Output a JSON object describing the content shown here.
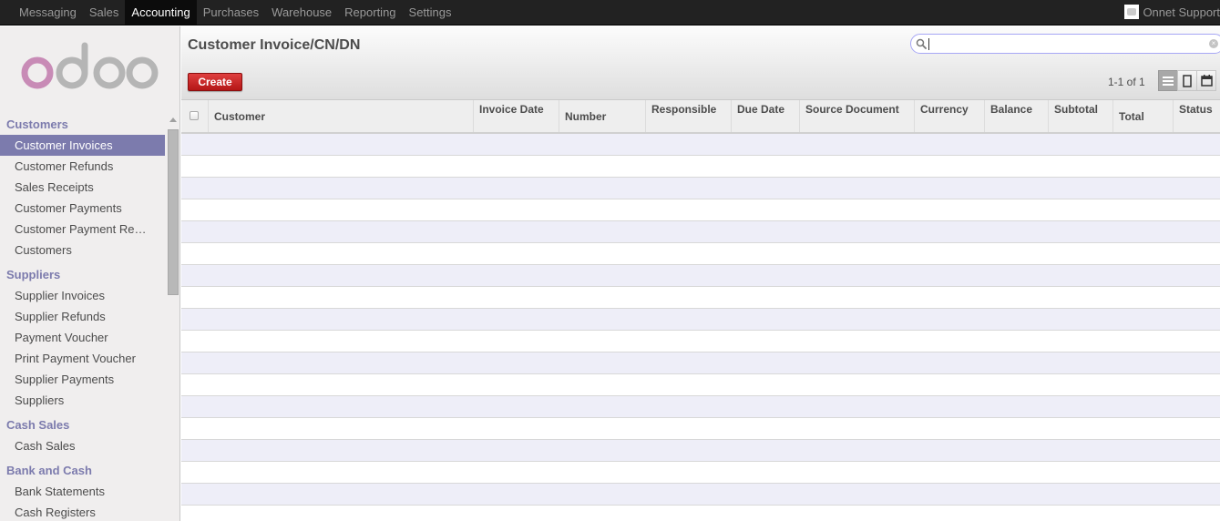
{
  "topbar": {
    "menu": [
      "Messaging",
      "Sales",
      "Accounting",
      "Purchases",
      "Warehouse",
      "Reporting",
      "Settings"
    ],
    "active_menu": "Accounting",
    "user_name": "Onnet Support",
    "avatar_icon": "user-avatar-icon"
  },
  "sidebar": {
    "logo_text": "odoo",
    "logo_colors": {
      "first_o": "#c88bb6",
      "rest": "#b5b5b5"
    },
    "sections": [
      {
        "label": "Customers",
        "items": [
          "Customer Invoices",
          "Customer Refunds",
          "Sales Receipts",
          "Customer Payments",
          "Customer Payment Re…",
          "Customers"
        ]
      },
      {
        "label": "Suppliers",
        "items": [
          "Supplier Invoices",
          "Supplier Refunds",
          "Payment Voucher",
          "Print Payment Voucher",
          "Supplier Payments",
          "Suppliers"
        ]
      },
      {
        "label": "Cash Sales",
        "items": [
          "Cash Sales"
        ]
      },
      {
        "label": "Bank and Cash",
        "items": [
          "Bank Statements",
          "Cash Registers"
        ]
      }
    ],
    "active_item": "Customer Invoices"
  },
  "header": {
    "title": "Customer Invoice/CN/DN",
    "create_label": "Create",
    "search_value": "",
    "pager": "1-1 of 1",
    "views": [
      "list-view-icon",
      "form-view-icon",
      "calendar-view-icon"
    ],
    "active_view": "list-view-icon"
  },
  "table": {
    "columns": [
      "Customer",
      "Invoice Date",
      "Number",
      "Responsible",
      "Due Date",
      "Source Document",
      "Currency",
      "Balance",
      "Subtotal",
      "Total",
      "Status"
    ],
    "rows": []
  },
  "colors": {
    "accent": "#7c7bad",
    "create_button": "#c62828",
    "topbar": "#222222",
    "row_alt": "#eeeef8"
  }
}
